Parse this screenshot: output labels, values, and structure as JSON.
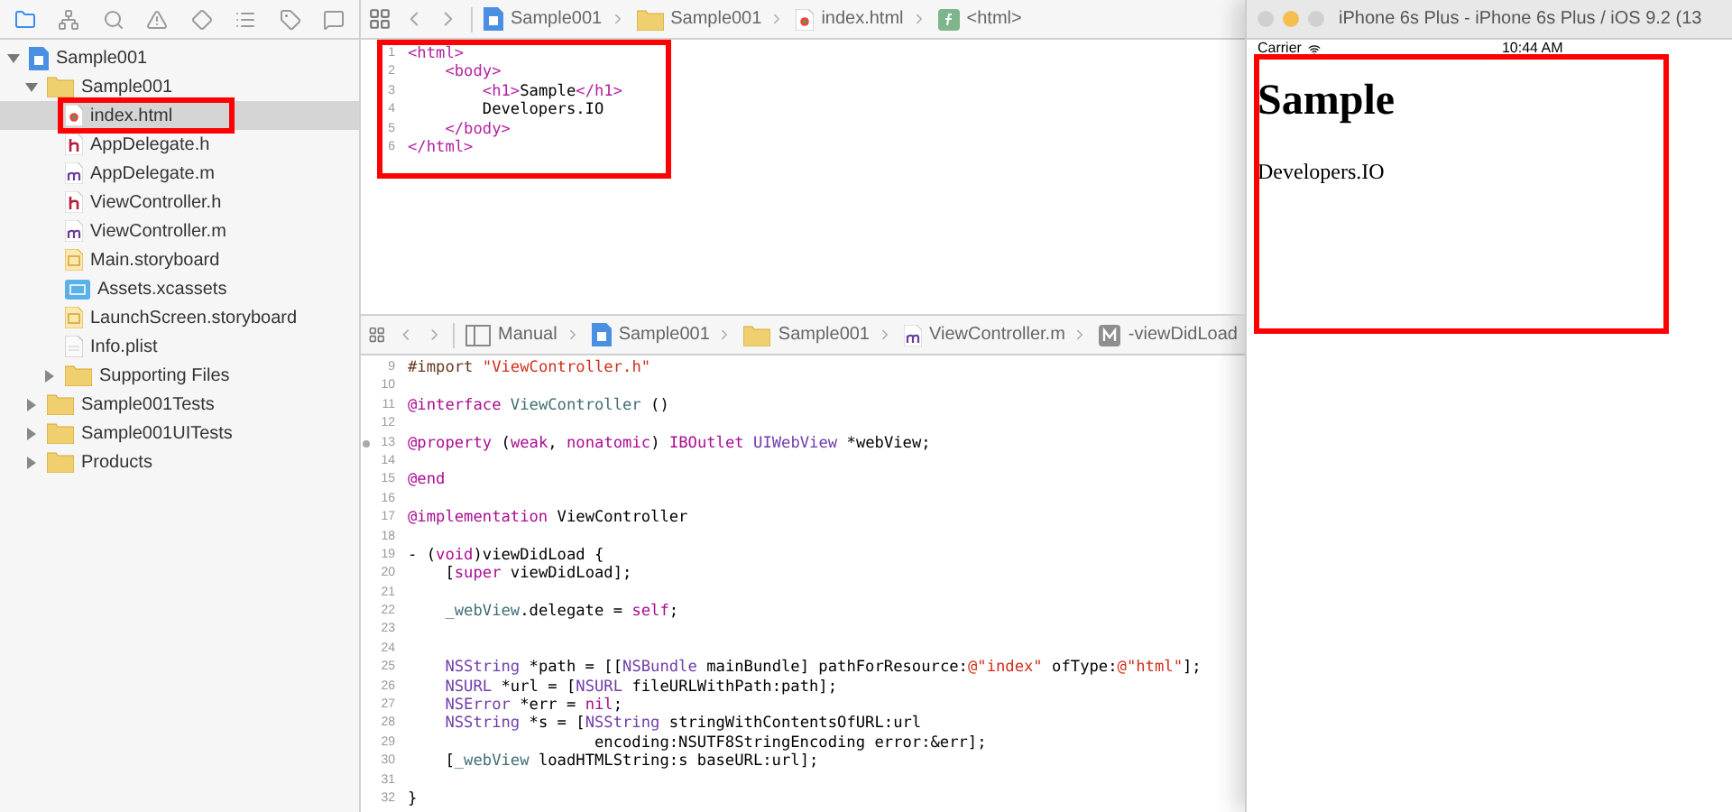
{
  "navigator": {
    "tabs": [
      {
        "selected": true
      },
      {
        "selected": false
      },
      {
        "selected": false
      },
      {
        "selected": false
      },
      {
        "selected": false
      },
      {
        "selected": false
      },
      {
        "selected": false
      },
      {
        "selected": false
      }
    ],
    "tree": [
      {
        "label": "Sample001",
        "kind": "project",
        "expanded": true,
        "selected": false,
        "highlighted": false,
        "children": [
          {
            "label": "Sample001",
            "kind": "folder",
            "expanded": true,
            "selected": false,
            "highlighted": false,
            "children": [
              {
                "label": "index.html",
                "kind": "html",
                "selected": true,
                "highlighted": true
              },
              {
                "label": "AppDelegate.h",
                "kind": "h",
                "selected": false,
                "highlighted": false
              },
              {
                "label": "AppDelegate.m",
                "kind": "m",
                "selected": false,
                "highlighted": false
              },
              {
                "label": "ViewController.h",
                "kind": "h",
                "selected": false,
                "highlighted": false
              },
              {
                "label": "ViewController.m",
                "kind": "m",
                "selected": false,
                "highlighted": false
              },
              {
                "label": "Main.storyboard",
                "kind": "storyboard",
                "selected": false,
                "highlighted": false
              },
              {
                "label": "Assets.xcassets",
                "kind": "assets",
                "selected": false,
                "highlighted": false
              },
              {
                "label": "LaunchScreen.storyboard",
                "kind": "storyboard",
                "selected": false,
                "highlighted": false
              },
              {
                "label": "Info.plist",
                "kind": "plist",
                "selected": false,
                "highlighted": false
              },
              {
                "label": "Supporting Files",
                "kind": "folder",
                "expanded": false,
                "selected": false,
                "highlighted": false
              }
            ]
          },
          {
            "label": "Sample001Tests",
            "kind": "folder",
            "expanded": false,
            "selected": false,
            "highlighted": false
          },
          {
            "label": "Sample001UITests",
            "kind": "folder",
            "expanded": false,
            "selected": false,
            "highlighted": false
          },
          {
            "label": "Products",
            "kind": "folder",
            "expanded": false,
            "selected": false,
            "highlighted": false
          }
        ]
      }
    ]
  },
  "editor_top": {
    "jump_bar": [
      {
        "label": "Sample001",
        "kind": "project"
      },
      {
        "label": "Sample001",
        "kind": "folder"
      },
      {
        "label": "index.html",
        "kind": "html"
      },
      {
        "label": "<html>",
        "kind": "symbol"
      }
    ],
    "highlighted": true,
    "lines": [
      {
        "num": "1",
        "tokens": [
          {
            "t": "<html>",
            "kind": "tag"
          }
        ]
      },
      {
        "num": "2",
        "tokens": [
          {
            "t": "    <body>",
            "kind": "tag"
          }
        ]
      },
      {
        "num": "3",
        "tokens": [
          {
            "t": "        <h1>",
            "kind": "tag"
          },
          {
            "t": "Sample",
            "kind": "plain"
          },
          {
            "t": "</h1>",
            "kind": "tag"
          }
        ]
      },
      {
        "num": "4",
        "tokens": [
          {
            "t": "        Developers.IO",
            "kind": "plain"
          }
        ]
      },
      {
        "num": "5",
        "tokens": [
          {
            "t": "    </body>",
            "kind": "tag"
          }
        ]
      },
      {
        "num": "6",
        "tokens": [
          {
            "t": "</html>",
            "kind": "tag"
          }
        ]
      }
    ]
  },
  "editor_bottom": {
    "jump_bar": [
      {
        "label": "Manual",
        "kind": "layout"
      },
      {
        "label": "Sample001",
        "kind": "project"
      },
      {
        "label": "Sample001",
        "kind": "folder"
      },
      {
        "label": "ViewController.m",
        "kind": "m"
      },
      {
        "label": "-viewDidLoad",
        "kind": "method"
      }
    ],
    "lines": [
      {
        "num": "9",
        "tokens": [
          {
            "t": "#import ",
            "kind": "prep"
          },
          {
            "t": "\"ViewController.h\"",
            "kind": "str"
          }
        ]
      },
      {
        "num": "10"
      },
      {
        "num": "11",
        "tokens": [
          {
            "t": "@interface ",
            "kind": "kw"
          },
          {
            "t": "ViewController",
            "kind": "cls"
          },
          {
            "t": " ()",
            "kind": "plain"
          }
        ]
      },
      {
        "num": "12"
      },
      {
        "num": "13",
        "breakpoint": true,
        "tokens": [
          {
            "t": "@property ",
            "kind": "kw"
          },
          {
            "t": "(",
            "kind": "plain"
          },
          {
            "t": "weak",
            "kind": "kw"
          },
          {
            "t": ", ",
            "kind": "plain"
          },
          {
            "t": "nonatomic",
            "kind": "kw"
          },
          {
            "t": ") ",
            "kind": "plain"
          },
          {
            "t": "IBOutlet ",
            "kind": "kw"
          },
          {
            "t": "UIWebView",
            "kind": "type"
          },
          {
            "t": " *webView;",
            "kind": "plain"
          }
        ]
      },
      {
        "num": "14"
      },
      {
        "num": "15",
        "tokens": [
          {
            "t": "@end",
            "kind": "kw"
          }
        ]
      },
      {
        "num": "16"
      },
      {
        "num": "17",
        "tokens": [
          {
            "t": "@implementation ",
            "kind": "kw"
          },
          {
            "t": "ViewController",
            "kind": "plain"
          }
        ]
      },
      {
        "num": "18"
      },
      {
        "num": "19",
        "tokens": [
          {
            "t": "- (",
            "kind": "plain"
          },
          {
            "t": "void",
            "kind": "kw"
          },
          {
            "t": ")viewDidLoad {",
            "kind": "plain"
          }
        ]
      },
      {
        "num": "20",
        "tokens": [
          {
            "t": "    [",
            "kind": "plain"
          },
          {
            "t": "super",
            "kind": "kw"
          },
          {
            "t": " viewDidLoad];",
            "kind": "plain"
          }
        ]
      },
      {
        "num": "21"
      },
      {
        "num": "22",
        "tokens": [
          {
            "t": "    _webView",
            "kind": "cls"
          },
          {
            "t": ".delegate = ",
            "kind": "plain"
          },
          {
            "t": "self",
            "kind": "kw"
          },
          {
            "t": ";",
            "kind": "plain"
          }
        ]
      },
      {
        "num": "23"
      },
      {
        "num": "24"
      },
      {
        "num": "25",
        "tokens": [
          {
            "t": "    NSString",
            "kind": "type"
          },
          {
            "t": " *path = [[",
            "kind": "plain"
          },
          {
            "t": "NSBundle",
            "kind": "type"
          },
          {
            "t": " mainBundle] pathForResource:",
            "kind": "plain"
          },
          {
            "t": "@\"index\"",
            "kind": "str"
          },
          {
            "t": " ofType:",
            "kind": "plain"
          },
          {
            "t": "@\"html\"",
            "kind": "str"
          },
          {
            "t": "];",
            "kind": "plain"
          }
        ]
      },
      {
        "num": "26",
        "tokens": [
          {
            "t": "    NSURL",
            "kind": "type"
          },
          {
            "t": " *url = [",
            "kind": "plain"
          },
          {
            "t": "NSURL",
            "kind": "type"
          },
          {
            "t": " fileURLWithPath:path];",
            "kind": "plain"
          }
        ]
      },
      {
        "num": "27",
        "tokens": [
          {
            "t": "    NSError",
            "kind": "type"
          },
          {
            "t": " *err = ",
            "kind": "plain"
          },
          {
            "t": "nil",
            "kind": "kw"
          },
          {
            "t": ";",
            "kind": "plain"
          }
        ]
      },
      {
        "num": "28",
        "tokens": [
          {
            "t": "    NSString",
            "kind": "type"
          },
          {
            "t": " *s = [",
            "kind": "plain"
          },
          {
            "t": "NSString",
            "kind": "type"
          },
          {
            "t": " stringWithContentsOfURL:url",
            "kind": "plain"
          }
        ]
      },
      {
        "num": "29",
        "tokens": [
          {
            "t": "                    encoding:NSUTF8StringEncoding error:&err];",
            "kind": "plain"
          }
        ]
      },
      {
        "num": "30",
        "tokens": [
          {
            "t": "    [",
            "kind": "plain"
          },
          {
            "t": "_webView",
            "kind": "cls"
          },
          {
            "t": " loadHTMLString:s baseURL:url];",
            "kind": "plain"
          }
        ]
      },
      {
        "num": "31"
      },
      {
        "num": "32",
        "tokens": [
          {
            "t": "}",
            "kind": "plain"
          }
        ]
      }
    ]
  },
  "simulator": {
    "title": "iPhone 6s Plus - iPhone 6s Plus / iOS 9.2 (13",
    "carrier": "Carrier",
    "time": "10:44 AM",
    "heading": "Sample",
    "body": "Developers.IO",
    "highlighted": true
  }
}
